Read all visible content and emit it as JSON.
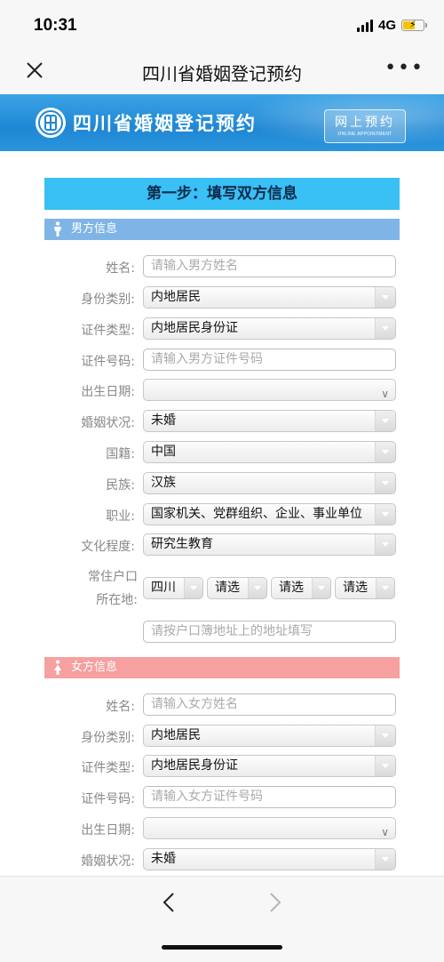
{
  "status": {
    "time": "10:31",
    "network": "4G"
  },
  "nav": {
    "title": "四川省婚姻登记预约",
    "more": "•••"
  },
  "banner": {
    "title": "四川省婚姻登记预约",
    "badge_main": "网上预约",
    "badge_sub": "ONLINE APPOINTMENT"
  },
  "step_header": "第一步：填写双方信息",
  "male": {
    "section_title": "男方信息",
    "name": {
      "label": "姓名:",
      "placeholder": "请输入男方姓名"
    },
    "id_kind": {
      "label": "身份类别:",
      "value": "内地居民"
    },
    "cert_type": {
      "label": "证件类型:",
      "value": "内地居民身份证"
    },
    "cert_no": {
      "label": "证件号码:",
      "placeholder": "请输入男方证件号码"
    },
    "birth": {
      "label": "出生日期:",
      "value": ""
    },
    "marital": {
      "label": "婚姻状况:",
      "value": "未婚"
    },
    "nationality": {
      "label": "国籍:",
      "value": "中国"
    },
    "ethnicity": {
      "label": "民族:",
      "value": "汉族"
    },
    "occupation": {
      "label": "职业:",
      "value": "国家机关、党群组织、企业、事业单位"
    },
    "education": {
      "label": "文化程度:",
      "value": "研究生教育"
    },
    "residence": {
      "label_line1": "常住户口",
      "label_line2": "所在地:",
      "province": "四川",
      "city": "请选",
      "district": "请选",
      "town": "请选",
      "address_placeholder": "请按户口簿地址上的地址填写"
    }
  },
  "female": {
    "section_title": "女方信息",
    "name": {
      "label": "姓名:",
      "placeholder": "请输入女方姓名"
    },
    "id_kind": {
      "label": "身份类别:",
      "value": "内地居民"
    },
    "cert_type": {
      "label": "证件类型:",
      "value": "内地居民身份证"
    },
    "cert_no": {
      "label": "证件号码:",
      "placeholder": "请输入女方证件号码"
    },
    "birth": {
      "label": "出生日期:",
      "value": ""
    },
    "marital": {
      "label": "婚姻状况:",
      "value": "未婚"
    }
  },
  "colors": {
    "banner": "#1f87d4",
    "step_header": "#39c0f4",
    "male_bar": "#7fb5e6",
    "female_bar": "#f6a0a0"
  },
  "icons": [
    "close-icon",
    "more-icon",
    "back-icon",
    "forward-icon",
    "male-person-icon",
    "female-person-icon",
    "dropdown-caret-icon",
    "calendar-chevron-icon"
  ]
}
